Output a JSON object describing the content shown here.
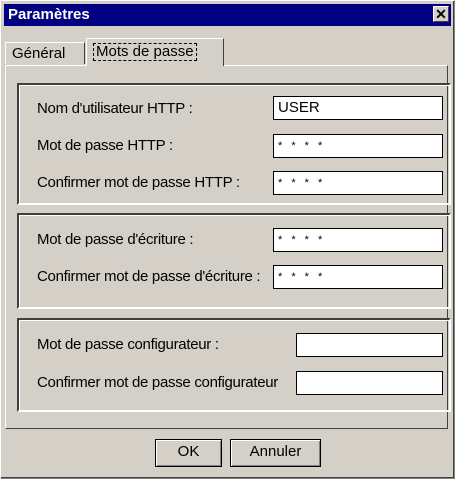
{
  "window": {
    "title": "Paramètres",
    "close_glyph": "✕"
  },
  "tabs": [
    {
      "label": "Général"
    },
    {
      "label": "Mots de passe",
      "active": true
    }
  ],
  "http_group": {
    "user_label": "Nom d'utilisateur HTTP :",
    "user_value": "USER",
    "password_label": "Mot de passe HTTP :",
    "password_value": "* * * *",
    "confirm_label": "Confirmer mot de passe HTTP :",
    "confirm_value": "* * * *"
  },
  "write_group": {
    "password_label": "Mot de passe d'écriture :",
    "password_value": "* * * *",
    "confirm_label": "Confirmer mot de passe d'écriture :",
    "confirm_value": "* * * *"
  },
  "config_group": {
    "password_label": "Mot de passe configurateur :",
    "password_value": "",
    "confirm_label": "Confirmer mot de passe configurateur",
    "confirm_value": ""
  },
  "buttons": {
    "ok": "OK",
    "cancel": "Annuler"
  },
  "colors": {
    "titlebar": "#000080",
    "face": "#d4d0c8"
  }
}
